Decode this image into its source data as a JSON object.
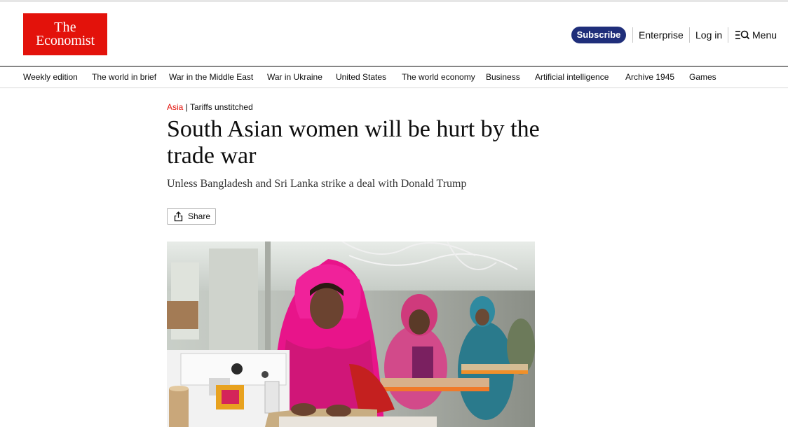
{
  "header": {
    "logo_line1": "The",
    "logo_line2": "Economist",
    "subscribe_label": "Subscribe",
    "enterprise_label": "Enterprise",
    "login_label": "Log in",
    "menu_label": "Menu",
    "menu_icon": "search-menu-icon"
  },
  "nav": {
    "items": [
      "Weekly edition",
      "The world in brief",
      "War in the Middle East",
      "War in Ukraine",
      "United States",
      "The world economy",
      "Business",
      "Artificial intelligence",
      "Archive 1945",
      "Games"
    ]
  },
  "article": {
    "section": "Asia",
    "divider": "|",
    "rubric": "Tariffs unstitched",
    "headline": "South Asian women will be hurt by the trade war",
    "standfirst": "Unless Bangladesh and Sri Lanka strike a deal with Donald Trump",
    "share_label": "Share",
    "share_icon": "share-icon"
  },
  "colors": {
    "brand_red": "#e3120b",
    "subscribe_blue": "#1f2e7a"
  }
}
